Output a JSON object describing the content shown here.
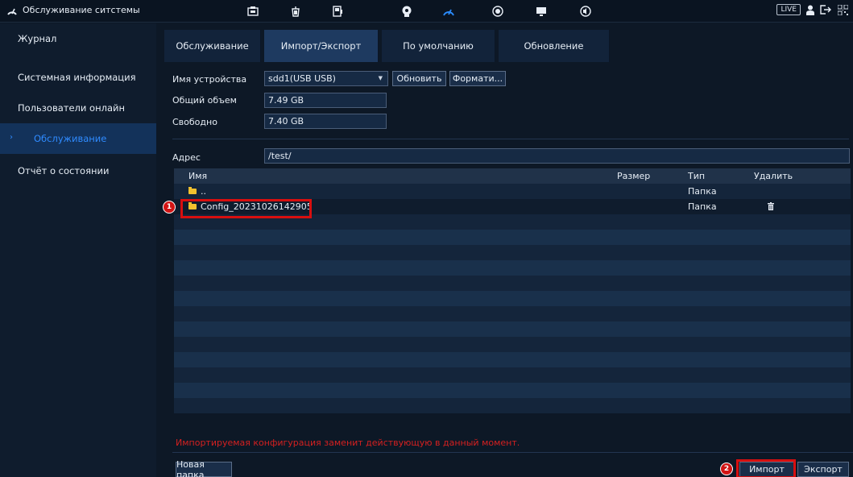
{
  "app": {
    "title": "Обслуживание ситстемы"
  },
  "topbar": {
    "icons": [
      "camera-settings-icon",
      "network-icon",
      "storage-icon",
      "ai-icon",
      "maintenance-icon",
      "event-icon",
      "display-icon",
      "audio-icon"
    ],
    "active_icon": "maintenance-icon",
    "live_label": "LIVE"
  },
  "sidebar": {
    "items": [
      {
        "label": "Журнал"
      },
      {
        "label": "Системная информация"
      },
      {
        "label": "Пользователи онлайн"
      },
      {
        "label": "Обслуживание",
        "active": true
      },
      {
        "label": "Отчёт о состоянии"
      }
    ]
  },
  "tabs": [
    {
      "label": "Обслуживание"
    },
    {
      "label": "Импорт/Экспорт",
      "active": true
    },
    {
      "label": "По умолчанию"
    },
    {
      "label": "Обновление"
    }
  ],
  "form": {
    "device_label": "Имя устройства",
    "device_value": "sdd1(USB USB)",
    "refresh_button": "Обновить",
    "format_button": "Формати...",
    "total_label": "Общий объем",
    "total_value": "7.49 GB",
    "free_label": "Свободно",
    "free_value": "7.40 GB",
    "address_label": "Адрес",
    "address_value": "/test/"
  },
  "table": {
    "columns": {
      "name": "Имя",
      "size": "Размер",
      "type": "Тип",
      "delete": "Удалить"
    },
    "rows": [
      {
        "name": "..",
        "size": "",
        "type": "Папка",
        "deletable": false
      },
      {
        "name": "Config_20231026142905",
        "size": "",
        "type": "Папка",
        "deletable": true
      }
    ]
  },
  "warning": "Импортируемая конфигурация заменит действующую в данный момент.",
  "buttons": {
    "new_folder": "Новая папка",
    "import": "Импорт",
    "export": "Экспорт"
  },
  "callouts": {
    "one": "1",
    "two": "2"
  },
  "colors": {
    "accent": "#2f8bff",
    "warning": "#d42020",
    "highlight": "#d80f0f",
    "folder": "#f2c12e"
  }
}
